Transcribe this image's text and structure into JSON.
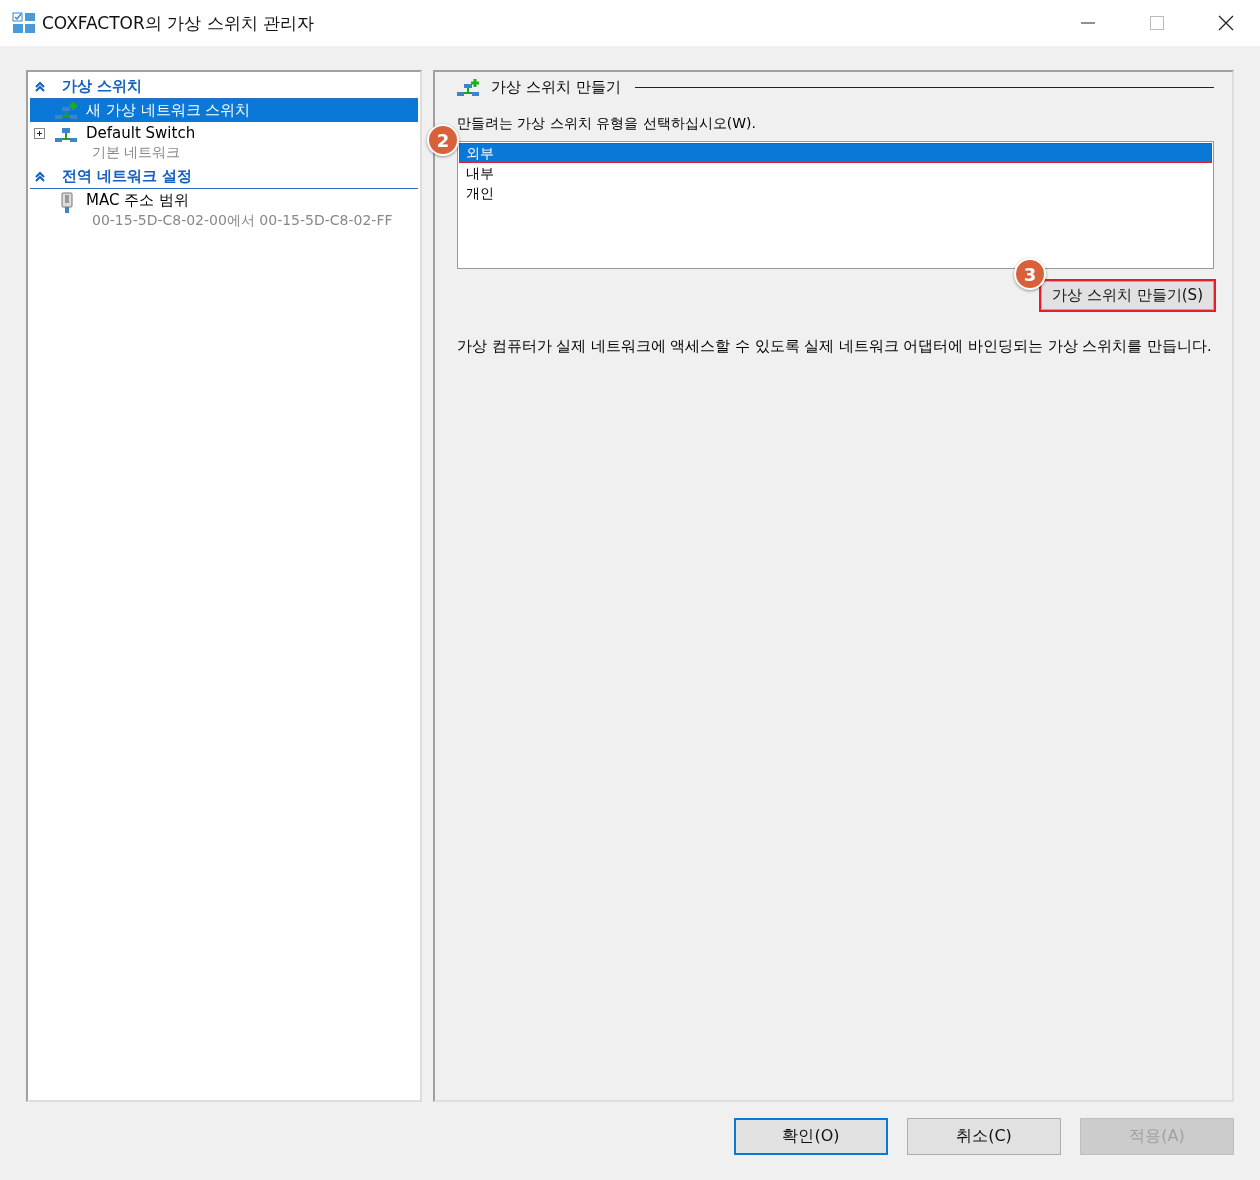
{
  "window": {
    "title": "COXFACTOR의 가상 스위치 관리자"
  },
  "sidebar": {
    "sections": [
      {
        "title": "가상 스위치",
        "expanded": true,
        "items": [
          {
            "kind": "new-switch",
            "label": "새 가상 네트워크 스위치",
            "selected": true
          },
          {
            "kind": "switch",
            "label": "Default Switch",
            "sublabel": "기본 네트워크",
            "selected": false,
            "expanded": false
          }
        ]
      },
      {
        "title": "전역 네트워크 설정",
        "expanded": true,
        "items": [
          {
            "kind": "mac",
            "label": "MAC 주소 범위",
            "sublabel": "00-15-5D-C8-02-00에서 00-15-5D-C8-02-FF",
            "selected": false
          }
        ]
      }
    ]
  },
  "panel": {
    "title": "가상 스위치 만들기",
    "prompt": "만들려는 가상 스위치 유형을 선택하십시오(W).",
    "options": [
      {
        "label": "외부",
        "selected": true,
        "highlighted": true
      },
      {
        "label": "내부",
        "selected": false,
        "highlighted": false
      },
      {
        "label": "개인",
        "selected": false,
        "highlighted": false
      }
    ],
    "options_callout": "2",
    "create_button": {
      "label": "가상 스위치 만들기(S)",
      "highlighted": true,
      "callout": "3"
    },
    "description": "가상 컴퓨터가 실제 네트워크에 액세스할 수 있도록 실제 네트워크 어댑터에 바인딩되는 가상 스위치를 만듭니다."
  },
  "buttons": [
    {
      "label": "확인(O)",
      "default": true,
      "disabled": false
    },
    {
      "label": "취소(C)",
      "default": false,
      "disabled": false
    },
    {
      "label": "적용(A)",
      "default": false,
      "disabled": true
    }
  ]
}
